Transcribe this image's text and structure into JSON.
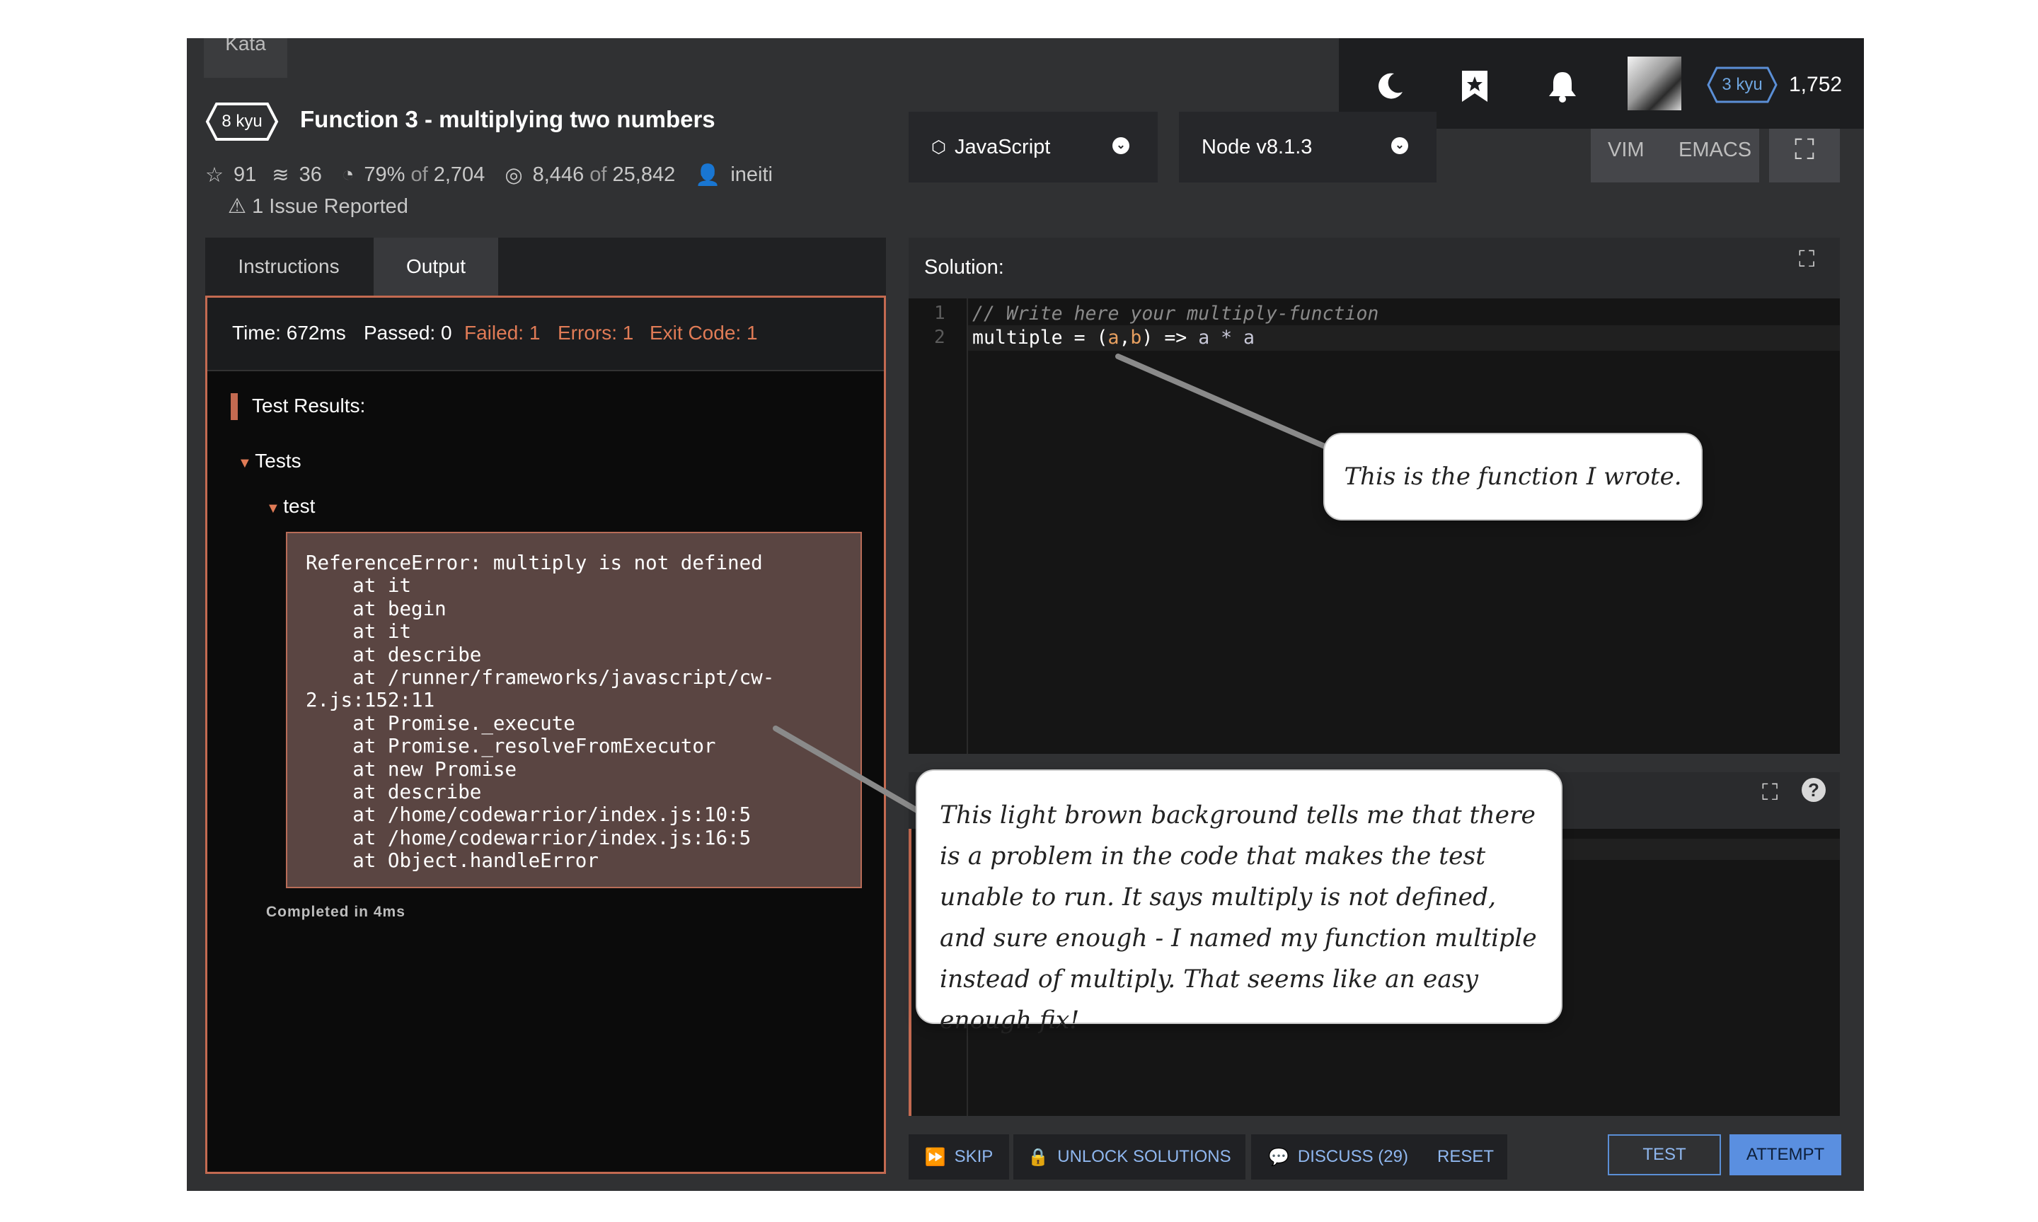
{
  "header": {
    "kata_tab": "Kata",
    "kyu_badge": "8 kyu",
    "title": "Function 3 - multiplying two numbers",
    "stats": {
      "stars": "91",
      "collections": "36",
      "satisfaction_pct": "79%",
      "satisfaction_of": "of",
      "satisfaction_votes": "2,704",
      "completed": "8,446",
      "completed_of": "of",
      "attempted": "25,842",
      "author": "ineiti"
    },
    "issues": "1 Issue Reported"
  },
  "topnav": {
    "user_rank": "3 kyu",
    "honor": "1,752",
    "icons": [
      "moon-icon",
      "bookmark-icon",
      "bell-icon"
    ]
  },
  "language_select": {
    "value": "JavaScript"
  },
  "version_select": {
    "value": "Node v8.1.3"
  },
  "editor_modes": {
    "vim": "VIM",
    "emacs": "EMACS"
  },
  "left_tabs": {
    "instructions": "Instructions",
    "output": "Output"
  },
  "output": {
    "time": "Time: 672ms",
    "passed": "Passed: 0",
    "failed": "Failed: 1",
    "errors": "Errors: 1",
    "exit_code": "Exit Code: 1",
    "results_title": "Test Results:",
    "group": "Tests",
    "test": "test",
    "error_trace": "ReferenceError: multiply is not defined\n    at it\n    at begin\n    at it\n    at describe\n    at /runner/frameworks/javascript/cw-\n2.js:152:11\n    at Promise._execute\n    at Promise._resolveFromExecutor\n    at new Promise\n    at describe\n    at /home/codewarrior/index.js:10:5\n    at /home/codewarrior/index.js:16:5\n    at Object.handleError",
    "completed": "Completed in 4ms"
  },
  "solution": {
    "label": "Solution:",
    "line_numbers": [
      "1",
      "2"
    ],
    "line1_comment": "// Write here your multiply-function",
    "line2": {
      "name": "multiple",
      "eq": " = ",
      "lparen": "(",
      "a": "a",
      "comma": ",",
      "b": "b",
      "rparen": ")",
      "arrow": " => ",
      "expr": "a * a"
    }
  },
  "actions": {
    "skip": "SKIP",
    "unlock": "UNLOCK SOLUTIONS",
    "discuss": "DISCUSS (29)",
    "reset": "RESET",
    "test": "TEST",
    "attempt": "ATTEMPT"
  },
  "annotations": {
    "callout1": "This is the function I wrote.",
    "callout2": "This light brown background tells me that there is a problem in the code that makes the test unable to run. It says multiply is not defined, and sure enough - I named my function multiple instead of multiply. That seems like an easy enough fix!"
  },
  "colors": {
    "accent_red": "#c36a51",
    "accent_blue": "#5a8fe0",
    "error_bg": "#5a4542"
  }
}
